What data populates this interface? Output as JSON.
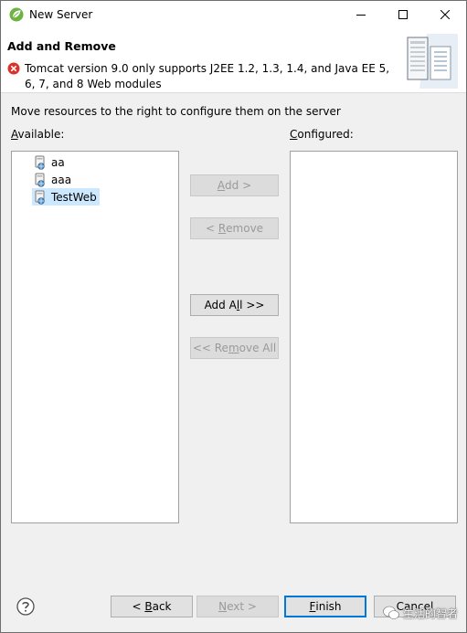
{
  "window": {
    "title": "New Server",
    "icon": "spring-leaf-icon",
    "controls": [
      "minimize",
      "maximize",
      "close"
    ]
  },
  "banner": {
    "title": "Add and Remove",
    "error_icon": "error-x-icon",
    "error_message": "Tomcat version 9.0 only supports J2EE 1.2, 1.3, 1.4, and Java EE 5, 6, 7, and 8 Web modules",
    "graphic": "server-wizard-graphic"
  },
  "content": {
    "instruction": "Move resources to the right to configure them on the server",
    "available_label": {
      "mnemonic": "A",
      "rest": "vailable:"
    },
    "configured_label": {
      "mnemonic": "C",
      "rest": "onfigured:"
    },
    "available_items": [
      {
        "label": "aa",
        "icon": "web-project-icon",
        "selected": false
      },
      {
        "label": "aaa",
        "icon": "web-project-icon",
        "selected": false
      },
      {
        "label": "TestWeb",
        "icon": "web-project-icon",
        "selected": true
      }
    ],
    "configured_items": []
  },
  "buttons": {
    "add": {
      "pre": "",
      "mnemonic": "A",
      "post": "dd >",
      "enabled": false
    },
    "remove": {
      "pre": "< ",
      "mnemonic": "R",
      "post": "emove",
      "enabled": false
    },
    "add_all": {
      "pre": "Add A",
      "mnemonic": "l",
      "post": "l >>",
      "enabled": true
    },
    "remove_all": {
      "pre": "<< Re",
      "mnemonic": "m",
      "post": "ove All",
      "enabled": false
    }
  },
  "footer": {
    "help_icon": "help-question-icon",
    "back": {
      "pre": "< ",
      "mnemonic": "B",
      "post": "ack",
      "enabled": true
    },
    "next": {
      "pre": "",
      "mnemonic": "N",
      "post": "ext >",
      "enabled": false
    },
    "finish": {
      "pre": "",
      "mnemonic": "F",
      "post": "inish",
      "enabled": true,
      "default": true
    },
    "cancel": {
      "label": "Cancel",
      "enabled": true
    },
    "watermark_text": "生活的智者"
  },
  "colors": {
    "selection": "#cce8ff",
    "default_button_border": "#0078d7",
    "error_red": "#d9342b"
  }
}
